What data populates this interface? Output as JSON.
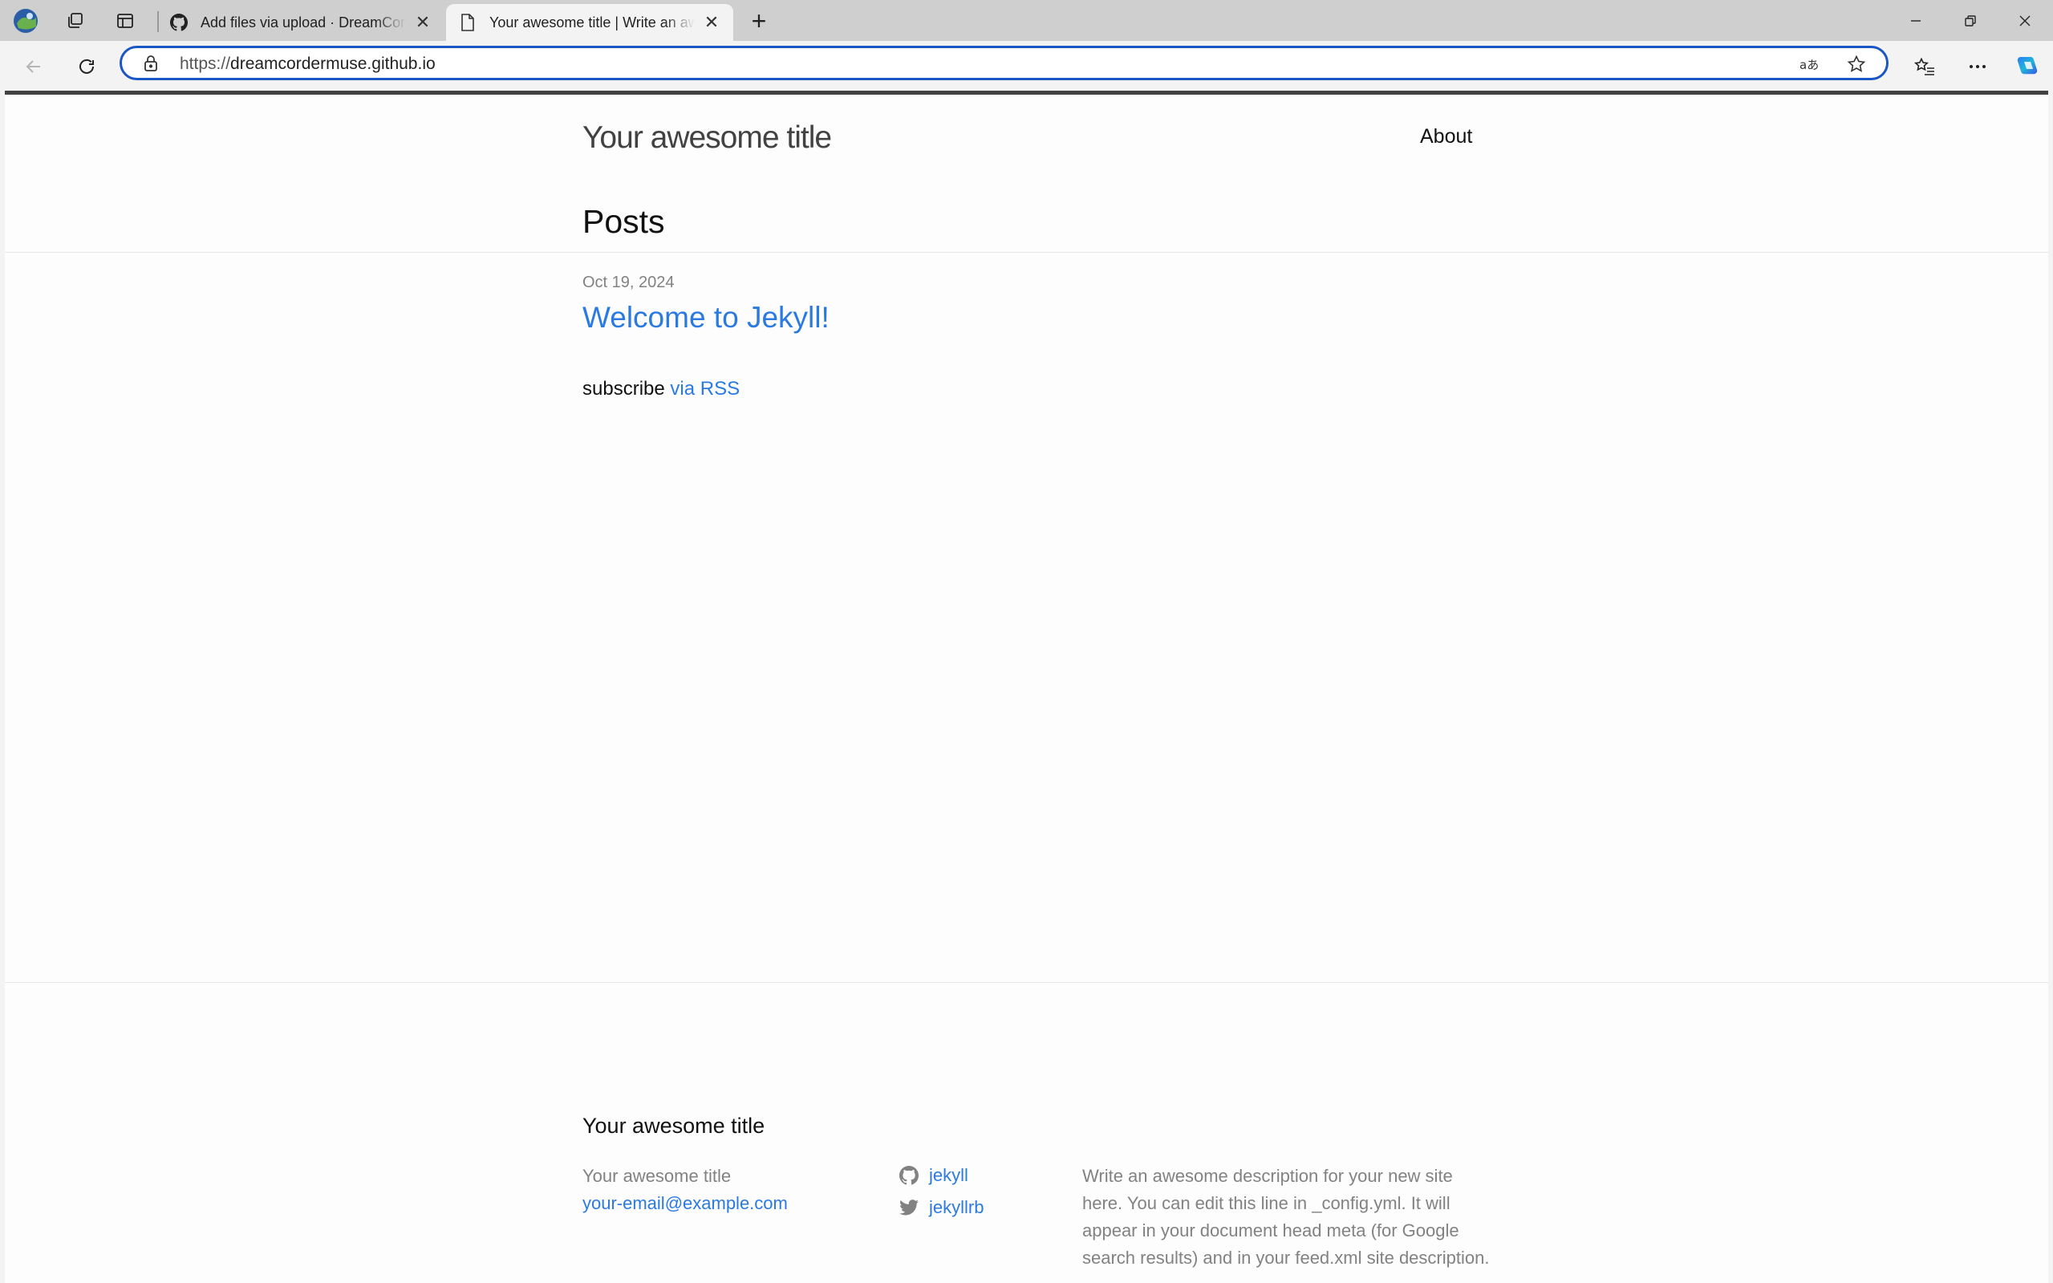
{
  "browser": {
    "tabs": [
      {
        "title": "Add files via upload · DreamCordermuse/dreamcordermuse.github.io",
        "active": false,
        "favicon": "github-icon"
      },
      {
        "title": "Your awesome title | Write an awesome description for your new site here.",
        "active": true,
        "favicon": "page-icon"
      }
    ],
    "address": {
      "protocol": "https://",
      "host": "dreamcordermuse.github.io"
    },
    "accent_color": "#1a56c4"
  },
  "page": {
    "header": {
      "site_title": "Your awesome title",
      "nav": [
        {
          "label": "About"
        }
      ]
    },
    "main": {
      "heading": "Posts",
      "posts": [
        {
          "date": "Oct 19, 2024",
          "title": "Welcome to Jekyll!"
        }
      ],
      "rss": {
        "prefix": "subscribe",
        "link_label": "via RSS"
      }
    },
    "footer": {
      "heading": "Your awesome title",
      "name": "Your awesome title",
      "email": "your-email@example.com",
      "social": [
        {
          "icon": "github-icon",
          "label": "jekyll"
        },
        {
          "icon": "twitter-icon",
          "label": "jekyllrb"
        }
      ],
      "description": "Write an awesome description for your new site here. You can edit this line in _config.yml. It will appear in your document head meta (for Google search results) and in your feed.xml site description."
    },
    "link_color": "#2a7ae2",
    "muted_color": "#828282"
  }
}
